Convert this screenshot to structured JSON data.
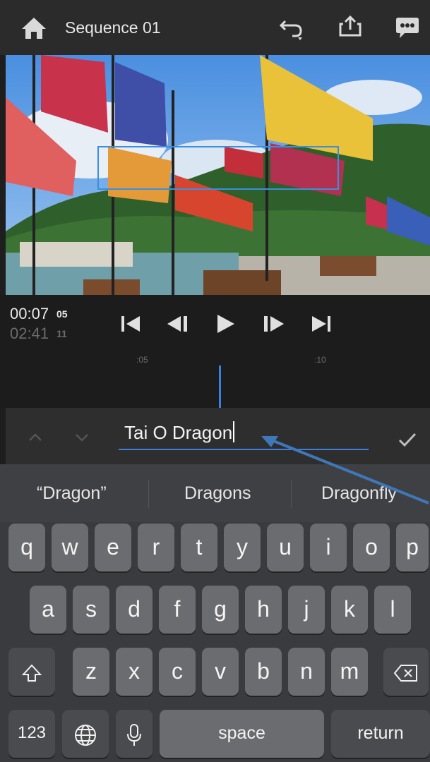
{
  "header": {
    "title": "Sequence 01",
    "icons": [
      "home-icon",
      "undo-icon",
      "share-icon",
      "comment-icon"
    ]
  },
  "playback": {
    "current_time": "00:07",
    "current_frames": "05",
    "total_time": "02:41",
    "total_frames": "11",
    "controls": [
      "skip-to-start-icon",
      "step-back-icon",
      "play-icon",
      "step-forward-icon",
      "skip-to-end-icon"
    ]
  },
  "timeline": {
    "tick_05": ":05",
    "tick_10": ":10"
  },
  "title_editor": {
    "value": "Tai O Dragon"
  },
  "keyboard": {
    "suggestions": [
      "“Dragon”",
      "Dragons",
      "Dragonfly"
    ],
    "row1": [
      "q",
      "w",
      "e",
      "r",
      "t",
      "y",
      "u",
      "i",
      "o",
      "p"
    ],
    "row2": [
      "a",
      "s",
      "d",
      "f",
      "g",
      "h",
      "j",
      "k",
      "l"
    ],
    "row3": [
      "z",
      "x",
      "c",
      "v",
      "b",
      "n",
      "m"
    ],
    "numbers_key": "123",
    "space_key": "space",
    "return_key": "return"
  },
  "colors": {
    "accent": "#3b7fe0",
    "annotation_arrow": "#3f77b8"
  }
}
